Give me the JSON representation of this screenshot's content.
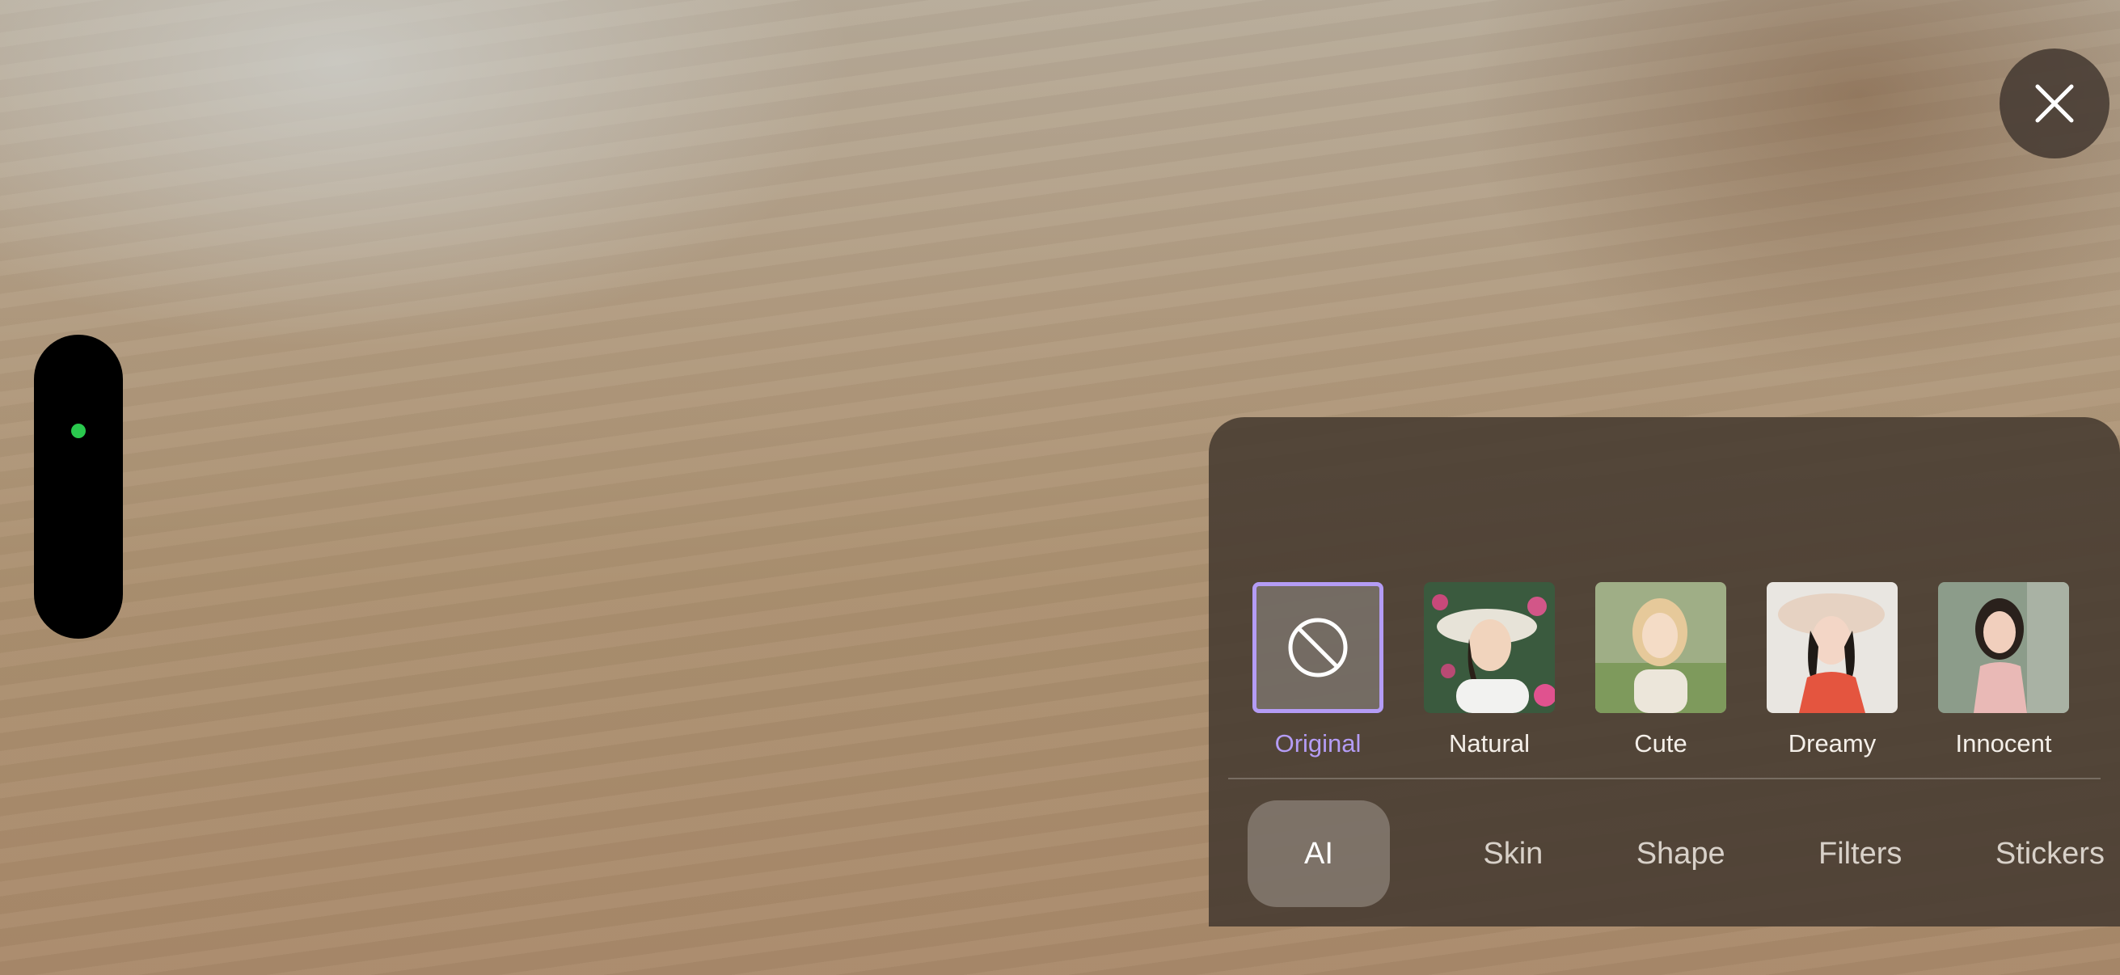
{
  "close": {
    "icon": "close-icon"
  },
  "recording_indicator": {
    "color": "#2ac94e"
  },
  "presets": [
    {
      "label": "Original",
      "selected": true,
      "icon": "no-effect-icon"
    },
    {
      "label": "Natural",
      "selected": false
    },
    {
      "label": "Cute",
      "selected": false
    },
    {
      "label": "Dreamy",
      "selected": false
    },
    {
      "label": "Innocent",
      "selected": false
    }
  ],
  "tabs": [
    {
      "label": "AI",
      "active": true
    },
    {
      "label": "Skin",
      "active": false
    },
    {
      "label": "Shape",
      "active": false
    },
    {
      "label": "Filters",
      "active": false
    },
    {
      "label": "Stickers",
      "active": false
    }
  ],
  "colors": {
    "accent": "#b49cf5",
    "panel": "#463a30"
  }
}
